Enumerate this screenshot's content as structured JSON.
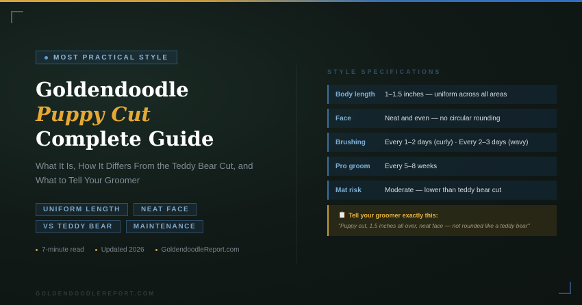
{
  "badge": {
    "label": "MOST PRACTICAL STYLE"
  },
  "title": {
    "line1": "Goldendoodle",
    "line2": "Puppy Cut",
    "line3": "Complete Guide"
  },
  "subtitle": "What It Is, How It Differs From the Teddy Bear Cut, and What to Tell Your Groomer",
  "tags": [
    "UNIFORM LENGTH",
    "NEAT FACE",
    "VS TEDDY BEAR",
    "MAINTENANCE"
  ],
  "meta": [
    "7-minute read",
    "Updated 2026",
    "GoldendoodleReport.com"
  ],
  "footer_brand": "GOLDENDOODLEREPORT.COM",
  "specs": {
    "heading": "STYLE SPECIFICATIONS",
    "rows": [
      {
        "key": "Body length",
        "value": "1–1.5 inches — uniform across all areas"
      },
      {
        "key": "Face",
        "value": "Neat and even — no circular rounding"
      },
      {
        "key": "Brushing",
        "value": "Every 1–2 days (curly) · Every 2–3 days (wavy)"
      },
      {
        "key": "Pro groom",
        "value": "Every 5–8 weeks"
      },
      {
        "key": "Mat risk",
        "value": "Moderate — lower than teddy bear cut"
      }
    ]
  },
  "tip": {
    "icon": "clipboard-icon",
    "title": "Tell your groomer exactly this:",
    "quote": "\"Puppy cut, 1.5 inches all over, neat face — not rounded like a teddy bear\""
  },
  "colors": {
    "accent_gold": "#e6a834",
    "accent_blue": "#7cb0d8"
  }
}
